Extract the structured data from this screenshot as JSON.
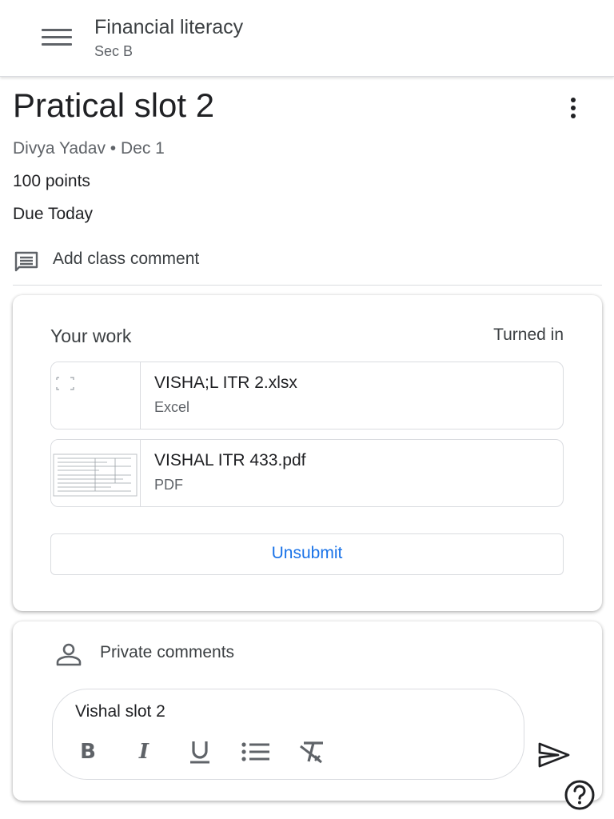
{
  "app": {
    "title": "Financial literacy",
    "subtitle": "Sec B"
  },
  "assignment": {
    "title": "Pratical slot 2",
    "meta": "Divya Yadav • Dec 1",
    "points": "100 points",
    "due": "Due Today",
    "add_comment": "Add class comment"
  },
  "work": {
    "title": "Your work",
    "status": "Turned in",
    "attachments": [
      {
        "name": "VISHA;L ITR 2.xlsx",
        "type": "Excel",
        "icon": "spreadsheet-thumbnail"
      },
      {
        "name": "VISHAL ITR 433.pdf",
        "type": "PDF",
        "icon": "pdf-document-thumbnail"
      }
    ],
    "unsubmit_label": "Unsubmit"
  },
  "private_comments": {
    "title": "Private comments",
    "draft": "Vishal slot 2",
    "tools": [
      "bold-icon",
      "italic-icon",
      "underline-icon",
      "bulleted-list-icon",
      "clear-formatting-icon"
    ]
  },
  "colors": {
    "accent": "#1a73e8",
    "text": "#202124",
    "muted": "#5f6368",
    "border": "#dadce0"
  }
}
